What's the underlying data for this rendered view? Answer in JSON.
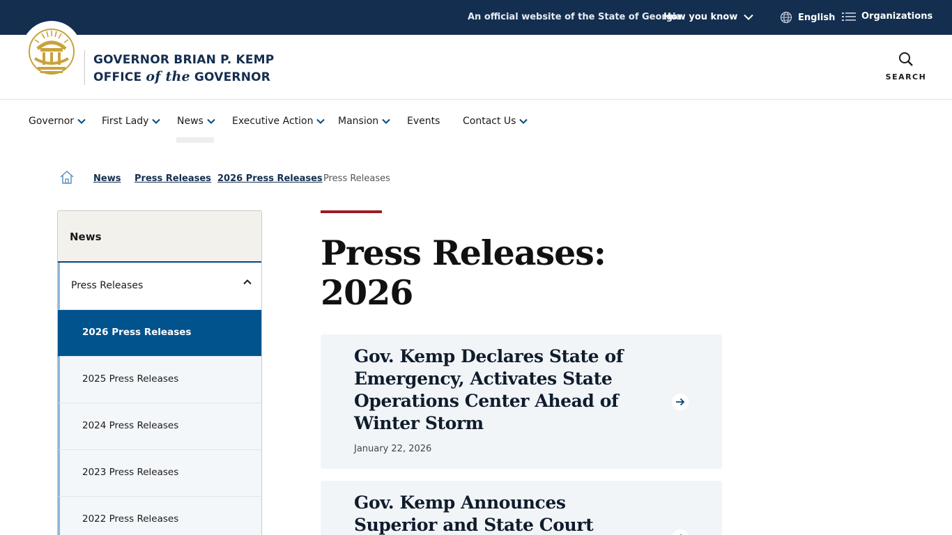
{
  "topbar": {
    "official_text": "An official website of the State of Georgia.",
    "how_you_know": "How you know",
    "language": "English",
    "organizations": "Organizations"
  },
  "header": {
    "brand_line1": "GOVERNOR BRIAN P. KEMP",
    "brand_line2_pre": "OFFICE ",
    "brand_line2_em": "of the",
    "brand_line2_post": " GOVERNOR",
    "search_label": "SEARCH"
  },
  "nav": {
    "items": [
      {
        "label": "Governor",
        "has_dropdown": true
      },
      {
        "label": "First Lady",
        "has_dropdown": true
      },
      {
        "label": "News",
        "has_dropdown": true,
        "active": true
      },
      {
        "label": "Executive Action",
        "has_dropdown": true
      },
      {
        "label": "Mansion",
        "has_dropdown": true
      },
      {
        "label": "Events",
        "has_dropdown": false
      },
      {
        "label": "Contact Us",
        "has_dropdown": true
      }
    ]
  },
  "breadcrumb": {
    "items": [
      "News",
      "Press Releases",
      "2026 Press Releases"
    ],
    "current": "Press Releases"
  },
  "sidebar": {
    "heading": "News",
    "parent": "Press Releases",
    "children": [
      "2026 Press Releases",
      "2025 Press Releases",
      "2024 Press Releases",
      "2023 Press Releases",
      "2022 Press Releases"
    ],
    "active_child": "2026 Press Releases"
  },
  "main": {
    "title_line1": "Press Releases:",
    "title_line2": "2026",
    "cards": [
      {
        "title": "Gov. Kemp Declares State of Emergency, Activates State Operations Center Ahead of Winter Storm",
        "date": "January 22, 2026"
      },
      {
        "title": "Gov. Kemp Announces Superior and State Court",
        "date": ""
      }
    ]
  },
  "colors": {
    "topbar_bg": "#132e4f",
    "brand_navy": "#132e4f",
    "active_blue": "#00538d",
    "accent_red": "#9b1c22",
    "seal_gold": "#c9a23b",
    "card_bg": "#f2f5f8"
  }
}
